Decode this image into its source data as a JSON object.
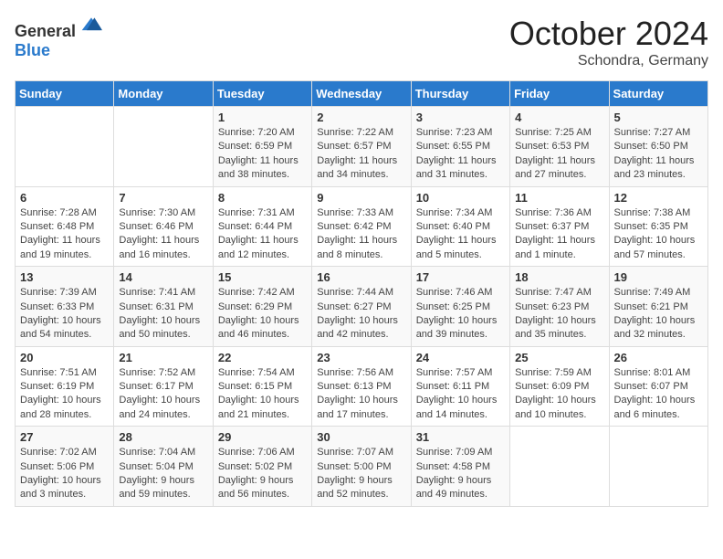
{
  "logo": {
    "general": "General",
    "blue": "Blue"
  },
  "header": {
    "month": "October 2024",
    "location": "Schondra, Germany"
  },
  "weekdays": [
    "Sunday",
    "Monday",
    "Tuesday",
    "Wednesday",
    "Thursday",
    "Friday",
    "Saturday"
  ],
  "weeks": [
    [
      {
        "day": "",
        "empty": true
      },
      {
        "day": "",
        "empty": true
      },
      {
        "day": "1",
        "sunrise": "Sunrise: 7:20 AM",
        "sunset": "Sunset: 6:59 PM",
        "daylight": "Daylight: 11 hours and 38 minutes."
      },
      {
        "day": "2",
        "sunrise": "Sunrise: 7:22 AM",
        "sunset": "Sunset: 6:57 PM",
        "daylight": "Daylight: 11 hours and 34 minutes."
      },
      {
        "day": "3",
        "sunrise": "Sunrise: 7:23 AM",
        "sunset": "Sunset: 6:55 PM",
        "daylight": "Daylight: 11 hours and 31 minutes."
      },
      {
        "day": "4",
        "sunrise": "Sunrise: 7:25 AM",
        "sunset": "Sunset: 6:53 PM",
        "daylight": "Daylight: 11 hours and 27 minutes."
      },
      {
        "day": "5",
        "sunrise": "Sunrise: 7:27 AM",
        "sunset": "Sunset: 6:50 PM",
        "daylight": "Daylight: 11 hours and 23 minutes."
      }
    ],
    [
      {
        "day": "6",
        "sunrise": "Sunrise: 7:28 AM",
        "sunset": "Sunset: 6:48 PM",
        "daylight": "Daylight: 11 hours and 19 minutes."
      },
      {
        "day": "7",
        "sunrise": "Sunrise: 7:30 AM",
        "sunset": "Sunset: 6:46 PM",
        "daylight": "Daylight: 11 hours and 16 minutes."
      },
      {
        "day": "8",
        "sunrise": "Sunrise: 7:31 AM",
        "sunset": "Sunset: 6:44 PM",
        "daylight": "Daylight: 11 hours and 12 minutes."
      },
      {
        "day": "9",
        "sunrise": "Sunrise: 7:33 AM",
        "sunset": "Sunset: 6:42 PM",
        "daylight": "Daylight: 11 hours and 8 minutes."
      },
      {
        "day": "10",
        "sunrise": "Sunrise: 7:34 AM",
        "sunset": "Sunset: 6:40 PM",
        "daylight": "Daylight: 11 hours and 5 minutes."
      },
      {
        "day": "11",
        "sunrise": "Sunrise: 7:36 AM",
        "sunset": "Sunset: 6:37 PM",
        "daylight": "Daylight: 11 hours and 1 minute."
      },
      {
        "day": "12",
        "sunrise": "Sunrise: 7:38 AM",
        "sunset": "Sunset: 6:35 PM",
        "daylight": "Daylight: 10 hours and 57 minutes."
      }
    ],
    [
      {
        "day": "13",
        "sunrise": "Sunrise: 7:39 AM",
        "sunset": "Sunset: 6:33 PM",
        "daylight": "Daylight: 10 hours and 54 minutes."
      },
      {
        "day": "14",
        "sunrise": "Sunrise: 7:41 AM",
        "sunset": "Sunset: 6:31 PM",
        "daylight": "Daylight: 10 hours and 50 minutes."
      },
      {
        "day": "15",
        "sunrise": "Sunrise: 7:42 AM",
        "sunset": "Sunset: 6:29 PM",
        "daylight": "Daylight: 10 hours and 46 minutes."
      },
      {
        "day": "16",
        "sunrise": "Sunrise: 7:44 AM",
        "sunset": "Sunset: 6:27 PM",
        "daylight": "Daylight: 10 hours and 42 minutes."
      },
      {
        "day": "17",
        "sunrise": "Sunrise: 7:46 AM",
        "sunset": "Sunset: 6:25 PM",
        "daylight": "Daylight: 10 hours and 39 minutes."
      },
      {
        "day": "18",
        "sunrise": "Sunrise: 7:47 AM",
        "sunset": "Sunset: 6:23 PM",
        "daylight": "Daylight: 10 hours and 35 minutes."
      },
      {
        "day": "19",
        "sunrise": "Sunrise: 7:49 AM",
        "sunset": "Sunset: 6:21 PM",
        "daylight": "Daylight: 10 hours and 32 minutes."
      }
    ],
    [
      {
        "day": "20",
        "sunrise": "Sunrise: 7:51 AM",
        "sunset": "Sunset: 6:19 PM",
        "daylight": "Daylight: 10 hours and 28 minutes."
      },
      {
        "day": "21",
        "sunrise": "Sunrise: 7:52 AM",
        "sunset": "Sunset: 6:17 PM",
        "daylight": "Daylight: 10 hours and 24 minutes."
      },
      {
        "day": "22",
        "sunrise": "Sunrise: 7:54 AM",
        "sunset": "Sunset: 6:15 PM",
        "daylight": "Daylight: 10 hours and 21 minutes."
      },
      {
        "day": "23",
        "sunrise": "Sunrise: 7:56 AM",
        "sunset": "Sunset: 6:13 PM",
        "daylight": "Daylight: 10 hours and 17 minutes."
      },
      {
        "day": "24",
        "sunrise": "Sunrise: 7:57 AM",
        "sunset": "Sunset: 6:11 PM",
        "daylight": "Daylight: 10 hours and 14 minutes."
      },
      {
        "day": "25",
        "sunrise": "Sunrise: 7:59 AM",
        "sunset": "Sunset: 6:09 PM",
        "daylight": "Daylight: 10 hours and 10 minutes."
      },
      {
        "day": "26",
        "sunrise": "Sunrise: 8:01 AM",
        "sunset": "Sunset: 6:07 PM",
        "daylight": "Daylight: 10 hours and 6 minutes."
      }
    ],
    [
      {
        "day": "27",
        "sunrise": "Sunrise: 7:02 AM",
        "sunset": "Sunset: 5:06 PM",
        "daylight": "Daylight: 10 hours and 3 minutes."
      },
      {
        "day": "28",
        "sunrise": "Sunrise: 7:04 AM",
        "sunset": "Sunset: 5:04 PM",
        "daylight": "Daylight: 9 hours and 59 minutes."
      },
      {
        "day": "29",
        "sunrise": "Sunrise: 7:06 AM",
        "sunset": "Sunset: 5:02 PM",
        "daylight": "Daylight: 9 hours and 56 minutes."
      },
      {
        "day": "30",
        "sunrise": "Sunrise: 7:07 AM",
        "sunset": "Sunset: 5:00 PM",
        "daylight": "Daylight: 9 hours and 52 minutes."
      },
      {
        "day": "31",
        "sunrise": "Sunrise: 7:09 AM",
        "sunset": "Sunset: 4:58 PM",
        "daylight": "Daylight: 9 hours and 49 minutes."
      },
      {
        "day": "",
        "empty": true
      },
      {
        "day": "",
        "empty": true
      }
    ]
  ]
}
